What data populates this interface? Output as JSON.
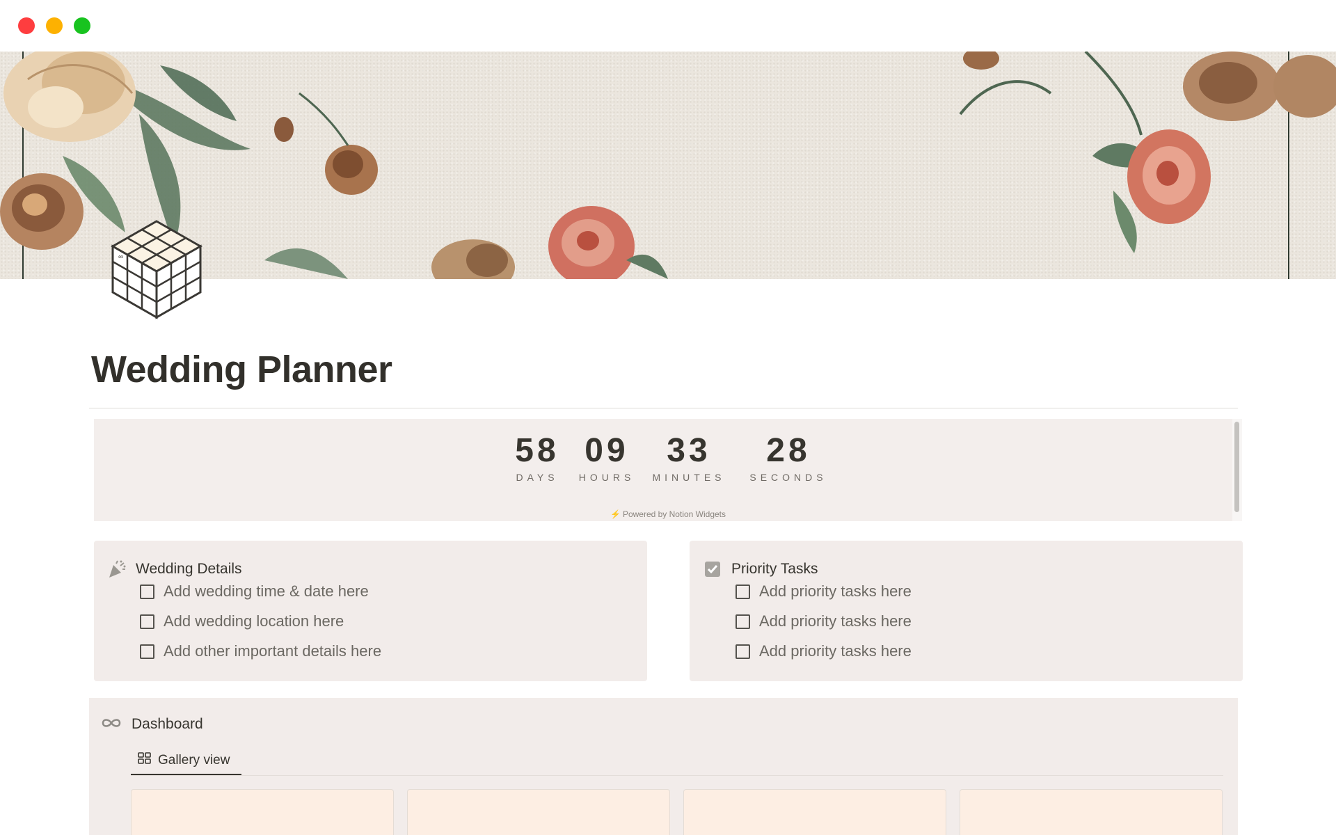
{
  "window": {
    "controls": [
      "close",
      "minimize",
      "zoom"
    ],
    "colors": {
      "close": "#fe3d3f",
      "minimize": "#fdb101",
      "zoom": "#18c31f"
    }
  },
  "cover": {
    "description_icon": "floral-wallpaper-cover"
  },
  "page": {
    "icon": "rubiks-cube-icon",
    "title": "Wedding Planner"
  },
  "countdown": {
    "units": [
      {
        "value": "58",
        "label": "DAYS"
      },
      {
        "value": "09",
        "label": "HOURS"
      },
      {
        "value": "33",
        "label": "MINUTES"
      },
      {
        "value": "28",
        "label": "SECONDS"
      }
    ],
    "powered_by": "Powered by Notion Widgets"
  },
  "wedding_details": {
    "title": "Wedding Details",
    "icon": "party-popper-icon",
    "items": [
      {
        "label": "Add wedding time & date here",
        "checked": false
      },
      {
        "label": "Add wedding location here",
        "checked": false
      },
      {
        "label": "Add other important details here",
        "checked": false
      }
    ]
  },
  "priority_tasks": {
    "title": "Priority Tasks",
    "icon": "checked-box-icon",
    "items": [
      {
        "label": "Add priority tasks here",
        "checked": false
      },
      {
        "label": "Add priority tasks here",
        "checked": false
      },
      {
        "label": "Add priority tasks here",
        "checked": false
      }
    ]
  },
  "dashboard": {
    "title": "Dashboard",
    "icon": "infinity-icon",
    "view_tab": "Gallery view",
    "cards": 4,
    "card_color": "#fdeee3"
  },
  "colors": {
    "panel_bg": "#f2ecea",
    "countdown_bg": "#f3eeec",
    "text": "#37352f"
  }
}
